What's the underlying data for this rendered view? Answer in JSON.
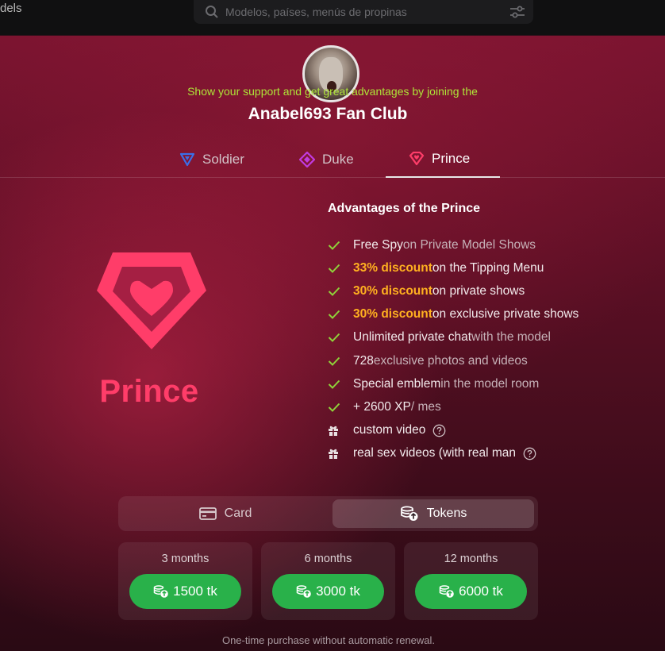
{
  "topbar": {
    "left_text": "dels",
    "search_placeholder": "Modelos, países, menús de propinas"
  },
  "modal": {
    "support_text": "Show your support and get great advantages by joining the",
    "club_title": "Anabel693 Fan Club",
    "tabs": [
      {
        "label": "Soldier",
        "icon": "triangle-gem-icon",
        "color": "#3b6fe8"
      },
      {
        "label": "Duke",
        "icon": "diamond-gem-icon",
        "color": "#c13be0"
      },
      {
        "label": "Prince",
        "icon": "heart-gem-icon",
        "color": "#ff3d69",
        "active": true
      }
    ],
    "tier_name": "Prince",
    "advantages_title": "Advantages of the Prince",
    "advantages": [
      {
        "type": "check",
        "main": "Free Spy",
        "rest": " on Private Model Shows"
      },
      {
        "type": "check",
        "highlight": "33% discount",
        "rest": " on the Tipping Menu"
      },
      {
        "type": "check",
        "highlight": "30% discount",
        "rest": " on private shows"
      },
      {
        "type": "check",
        "highlight": "30% discount",
        "rest": " on exclusive private shows"
      },
      {
        "type": "check",
        "main": "Unlimited private chat",
        "rest": " with the model"
      },
      {
        "type": "check",
        "main": "728",
        "rest": " exclusive photos and videos"
      },
      {
        "type": "check",
        "main": "Special emblem",
        "rest": " in the model room"
      },
      {
        "type": "check",
        "main": "+ 2600 XP",
        "rest": " / mes"
      },
      {
        "type": "gift",
        "main": "custom video",
        "help": true
      },
      {
        "type": "gift",
        "main": "real sex videos (with real man",
        "help": true
      }
    ],
    "payment": {
      "card_label": "Card",
      "tokens_label": "Tokens",
      "selected": "Tokens"
    },
    "plans": [
      {
        "period": "3 months",
        "price": "1500 tk"
      },
      {
        "period": "6 months",
        "price": "3000 tk"
      },
      {
        "period": "12 months",
        "price": "6000 tk"
      }
    ],
    "footnote": "One-time purchase without automatic renewal.",
    "colors": {
      "accent": "#ff3d69",
      "support_text": "#aee538",
      "highlight": "#ffb020",
      "check": "#8fd33a",
      "buy_button": "#29b14a"
    }
  }
}
